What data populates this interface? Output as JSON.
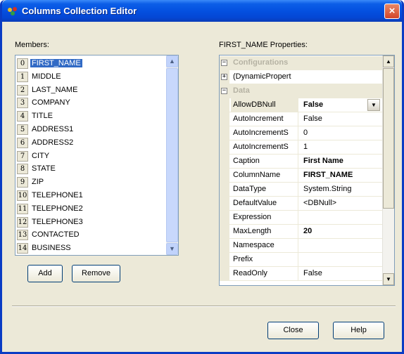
{
  "window": {
    "title": "Columns Collection Editor",
    "close_glyph": "×"
  },
  "members": {
    "label": "Members:",
    "items": [
      {
        "index": "0",
        "name": "FIRST_NAME"
      },
      {
        "index": "1",
        "name": "MIDDLE"
      },
      {
        "index": "2",
        "name": "LAST_NAME"
      },
      {
        "index": "3",
        "name": "COMPANY"
      },
      {
        "index": "4",
        "name": "TITLE"
      },
      {
        "index": "5",
        "name": "ADDRESS1"
      },
      {
        "index": "6",
        "name": "ADDRESS2"
      },
      {
        "index": "7",
        "name": "CITY"
      },
      {
        "index": "8",
        "name": "STATE"
      },
      {
        "index": "9",
        "name": "ZIP"
      },
      {
        "index": "10",
        "name": "TELEPHONE1"
      },
      {
        "index": "11",
        "name": "TELEPHONE2"
      },
      {
        "index": "12",
        "name": "TELEPHONE3"
      },
      {
        "index": "13",
        "name": "CONTACTED"
      },
      {
        "index": "14",
        "name": "BUSINESS"
      }
    ],
    "selected_index": 0
  },
  "buttons": {
    "add": "Add",
    "remove": "Remove",
    "close": "Close",
    "help": "Help"
  },
  "properties": {
    "label": "FIRST_NAME Properties:",
    "categories": {
      "configurations": "Configurations",
      "dynamic": "(DynamicPropert",
      "data": "Data"
    },
    "rows": [
      {
        "name": "AllowDBNull",
        "value": "False",
        "bold": true,
        "dropdown": true
      },
      {
        "name": "AutoIncrement",
        "value": "False",
        "bold": false
      },
      {
        "name": "AutoIncrementS",
        "value": "0",
        "bold": false
      },
      {
        "name": "AutoIncrementS",
        "value": "1",
        "bold": false
      },
      {
        "name": "Caption",
        "value": "First Name",
        "bold": true
      },
      {
        "name": "ColumnName",
        "value": "FIRST_NAME",
        "bold": true
      },
      {
        "name": "DataType",
        "value": "System.String",
        "bold": false
      },
      {
        "name": "DefaultValue",
        "value": "<DBNull>",
        "bold": false
      },
      {
        "name": "Expression",
        "value": "",
        "bold": false
      },
      {
        "name": "MaxLength",
        "value": "20",
        "bold": true
      },
      {
        "name": "Namespace",
        "value": "",
        "bold": false
      },
      {
        "name": "Prefix",
        "value": "",
        "bold": false
      },
      {
        "name": "ReadOnly",
        "value": "False",
        "bold": false
      }
    ]
  },
  "icons": {
    "scroll_up": "▲",
    "scroll_down": "▼",
    "dropdown": "▼",
    "minus": "−",
    "plus": "+"
  },
  "colors": {
    "titlebar": "#0450e0",
    "selection": "#316ac5",
    "face": "#ece9d8"
  }
}
